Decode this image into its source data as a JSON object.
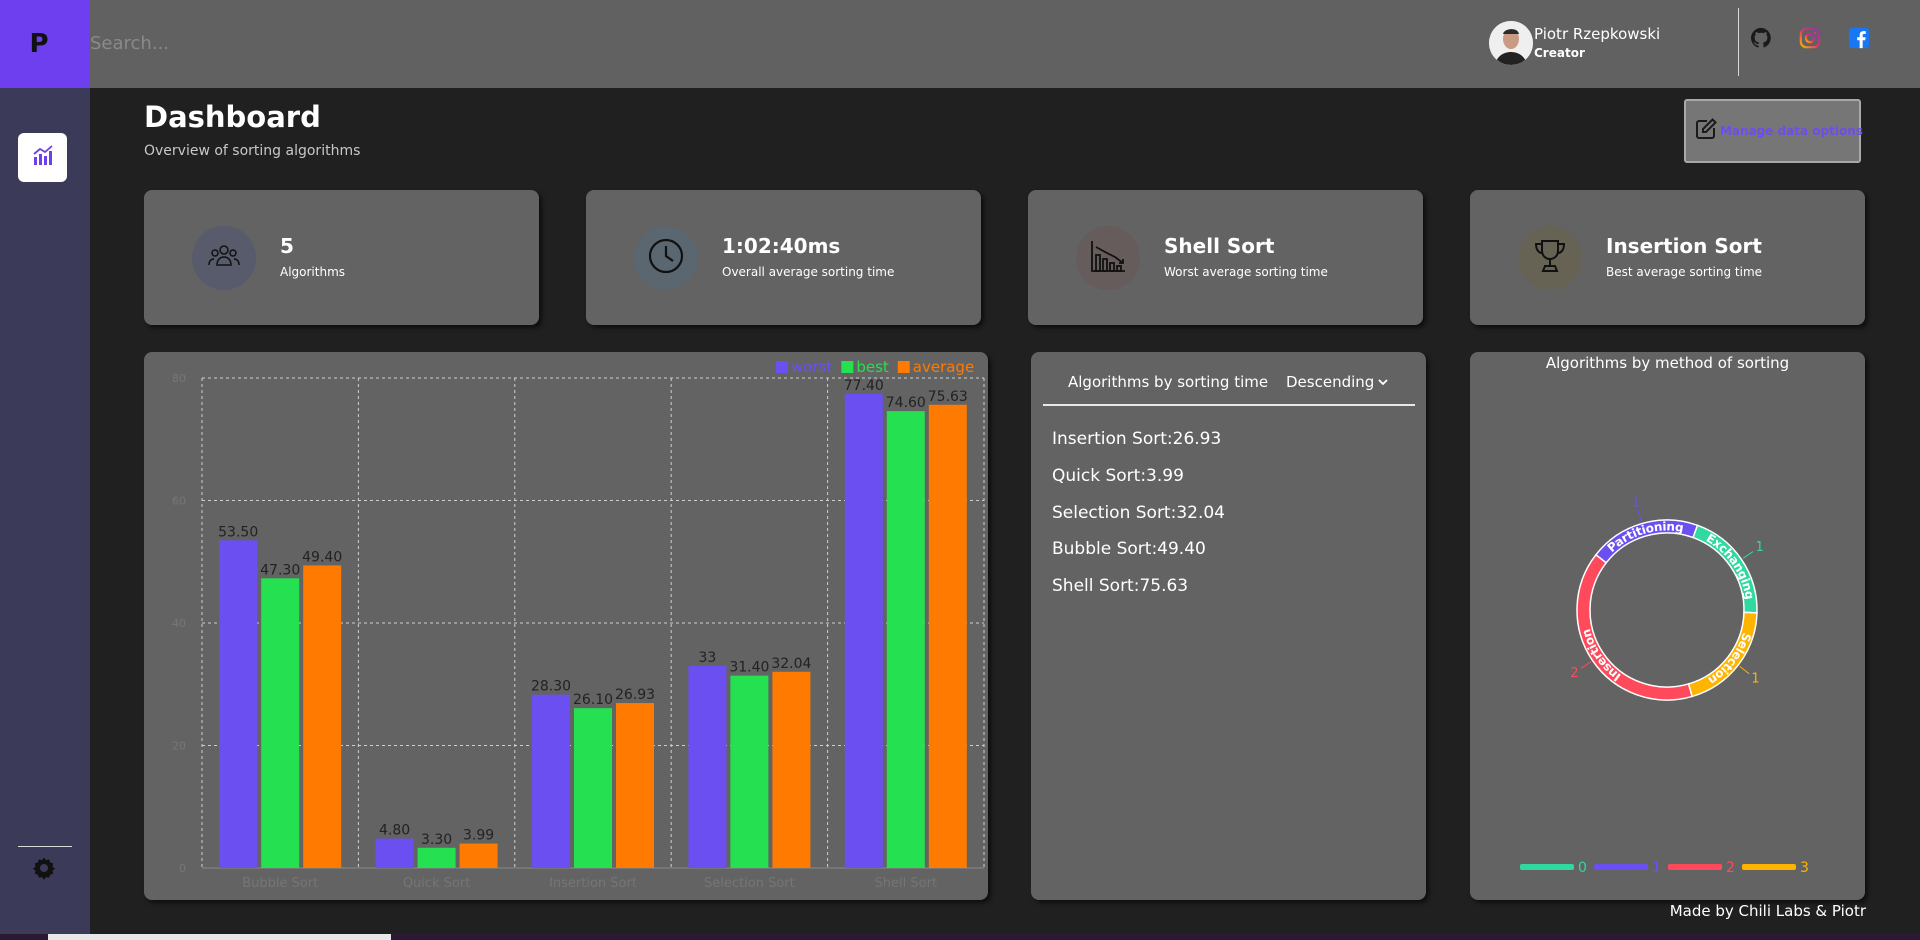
{
  "app": {
    "logo": "P"
  },
  "sidebar": {
    "items": [
      {
        "icon": "chart-icon"
      },
      {
        "icon": "gear-icon"
      }
    ]
  },
  "header": {
    "search_placeholder": "Search...",
    "user": {
      "name": "Piotr Rzepkowski",
      "role": "Creator"
    },
    "social": [
      "github-icon",
      "instagram-icon",
      "facebook-icon"
    ]
  },
  "page": {
    "title": "Dashboard",
    "subtitle": "Overview of sorting algorithms",
    "manage_button": "Manage data options"
  },
  "stats": [
    {
      "icon": "users-icon",
      "value": "5",
      "label": "Algorithms",
      "icon_bg": "#585b6b"
    },
    {
      "icon": "clock-icon",
      "value": "1:02:40ms",
      "label": "Overall average sorting time",
      "icon_bg": "#5a6670"
    },
    {
      "icon": "trend-down-icon",
      "value": "Shell Sort",
      "label": "Worst average sorting time",
      "icon_bg": "#665c5c"
    },
    {
      "icon": "trophy-icon",
      "value": "Insertion Sort",
      "label": "Best average sorting time",
      "icon_bg": "#676354"
    }
  ],
  "chart_data": {
    "type": "bar",
    "categories": [
      "Bubble Sort",
      "Quick Sort",
      "Insertion Sort",
      "Selection Sort",
      "Shell Sort"
    ],
    "series": [
      {
        "name": "worst",
        "color": "#6c4ff0",
        "values": [
          53.5,
          4.8,
          28.3,
          33,
          77.4
        ],
        "labels": [
          "53.50",
          "4.80",
          "28.30",
          "33",
          "77.40"
        ]
      },
      {
        "name": "best",
        "color": "#25e050",
        "values": [
          47.3,
          3.3,
          26.1,
          31.4,
          74.6
        ],
        "labels": [
          "47.30",
          "3.30",
          "26.10",
          "31.40",
          "74.60"
        ]
      },
      {
        "name": "average",
        "color": "#ff7a00",
        "values": [
          49.4,
          3.99,
          26.93,
          32.04,
          75.63
        ],
        "labels": [
          "49.40",
          "3.99",
          "26.93",
          "32.04",
          "75.63"
        ]
      }
    ],
    "ylim": [
      0,
      80
    ],
    "yticks": [
      "0",
      "20",
      "40",
      "60",
      "80"
    ],
    "grid": true,
    "legend": "top-right"
  },
  "sorting_list": {
    "header": "Algorithms by sorting time",
    "order": "Descending",
    "items": [
      "Insertion Sort:26.93",
      "Quick Sort:3.99",
      "Selection Sort:32.04",
      "Bubble Sort:49.40",
      "Shell Sort:75.63"
    ]
  },
  "method_chart": {
    "title": "Algorithms by method of sorting",
    "segments": [
      {
        "label": "Partitioning",
        "value": 1,
        "color": "#6c4ff0"
      },
      {
        "label": "Exchanging",
        "value": 1,
        "color": "#2fd9a0"
      },
      {
        "label": "Selection",
        "value": 1,
        "color": "#ffb400"
      },
      {
        "label": "Insertion",
        "value": 2,
        "color": "#ff4a5c"
      }
    ],
    "legend": [
      {
        "label": "0",
        "color": "#2fd9a0"
      },
      {
        "label": "1",
        "color": "#6c4ff0"
      },
      {
        "label": "2",
        "color": "#ff4a5c"
      },
      {
        "label": "3",
        "color": "#ffb400"
      }
    ]
  },
  "footer": {
    "credit": "Made by Chili Labs & Piotr"
  }
}
